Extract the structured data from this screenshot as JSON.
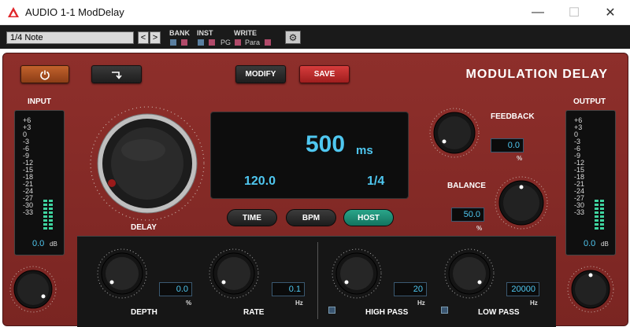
{
  "window": {
    "title": "AUDIO 1-1 ModDelay",
    "minimize": "—",
    "maximize": "☐",
    "close": "✕"
  },
  "toolbar": {
    "preset": "1/4 Note",
    "prev": "<",
    "next": ">",
    "bank": "BANK",
    "inst": "INST",
    "write": "WRITE",
    "pg": "PG",
    "para": "Para"
  },
  "plugin": {
    "title": "MODULATION DELAY",
    "modify": "MODIFY",
    "save": "SAVE",
    "input_label": "INPUT",
    "output_label": "OUTPUT",
    "meter_scale": [
      "+6",
      "+3",
      "0",
      "-3",
      "-6",
      "-9",
      "-12",
      "-15",
      "-18",
      "-21",
      "-24",
      "-27",
      "-30",
      "-33"
    ],
    "input_value": "0.0",
    "output_value": "0.0",
    "db": "dB",
    "delay_label": "DELAY",
    "display": {
      "delay": "500",
      "unit": "ms",
      "bpm": "120.0",
      "note": "1/4"
    },
    "modes": {
      "time": "TIME",
      "bpm": "BPM",
      "host": "HOST"
    },
    "feedback": {
      "label": "FEEDBACK",
      "value": "0.0",
      "unit": "%"
    },
    "balance": {
      "label": "BALANCE",
      "value": "50.0",
      "unit": "%"
    },
    "depth": {
      "label": "DEPTH",
      "value": "0.0",
      "unit": "%"
    },
    "rate": {
      "label": "RATE",
      "value": "0.1",
      "unit": "Hz"
    },
    "high_pass": {
      "label": "HIGH PASS",
      "value": "20",
      "unit": "Hz"
    },
    "low_pass": {
      "label": "LOW PASS",
      "value": "20000",
      "unit": "Hz"
    }
  },
  "colors": {
    "accent": "#4fc7f0",
    "panel": "#8e2f2b",
    "host_active": "#2aa58a",
    "save": "#d63c3c"
  }
}
